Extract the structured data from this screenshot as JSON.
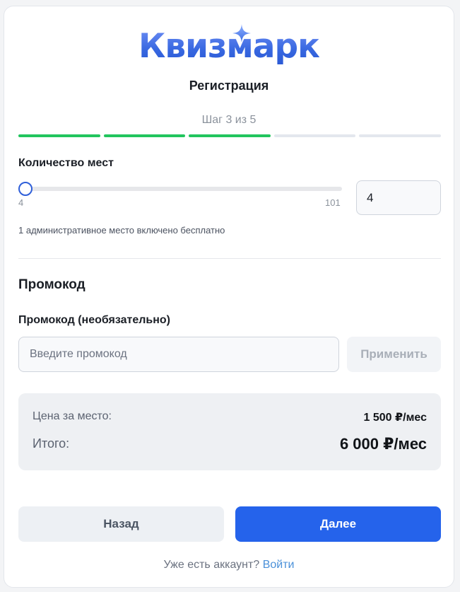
{
  "brand": {
    "logo_text": "Квизмарк",
    "accent_color": "#2563eb",
    "logo_icon": "sparkle-icon"
  },
  "header": {
    "title": "Регистрация",
    "step_text": "Шаг 3 из 5"
  },
  "progress": {
    "completed_steps": 3,
    "total_steps": 5,
    "done_color": "#22c55e"
  },
  "seats": {
    "label": "Количество мест",
    "min_label": "4",
    "max_label": "101",
    "min": 4,
    "max": 101,
    "value": "4",
    "hint": "1 административное место включено бесплатно"
  },
  "promo": {
    "section_title": "Промокод",
    "field_label": "Промокод (необязательно)",
    "placeholder": "Введите промокод",
    "value": "",
    "apply_label": "Применить"
  },
  "summary": {
    "price_label": "Цена за место:",
    "price_value": "1 500 ₽/мес",
    "total_label": "Итого:",
    "total_value": "6 000 ₽/мес"
  },
  "actions": {
    "back_label": "Назад",
    "next_label": "Далее"
  },
  "footer": {
    "text": "Уже есть аккаунт?",
    "login_link": "Войти"
  }
}
